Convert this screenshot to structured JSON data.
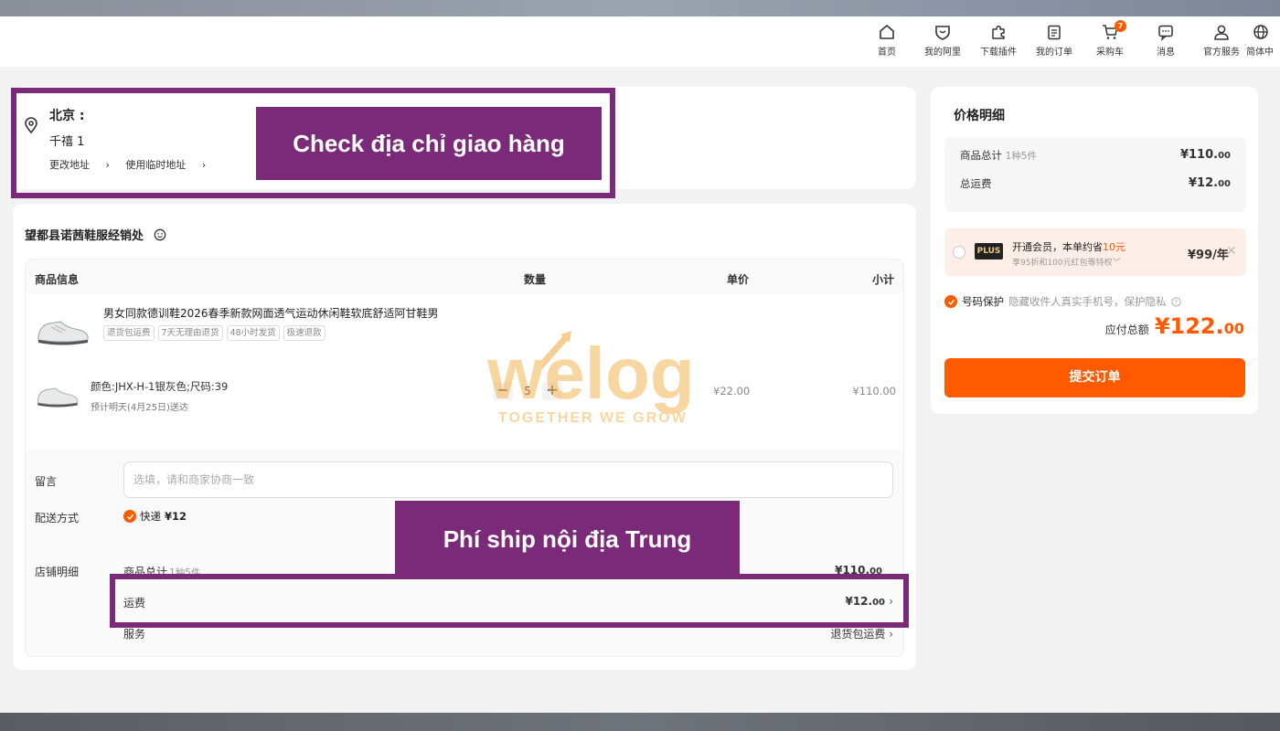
{
  "nav": {
    "items": [
      {
        "label": "首页",
        "icon": "home-icon"
      },
      {
        "label": "我的阿里",
        "icon": "heart-shield-icon"
      },
      {
        "label": "下载插件",
        "icon": "puzzle-icon"
      },
      {
        "label": "我的订单",
        "icon": "clipboard-icon"
      },
      {
        "label": "采购车",
        "icon": "cart-icon",
        "badge": "7"
      },
      {
        "label": "消息",
        "icon": "message-icon"
      },
      {
        "label": "官方服务",
        "icon": "user-icon"
      },
      {
        "label": "简体中",
        "icon": "globe-icon"
      }
    ]
  },
  "address": {
    "city": "北京 :",
    "detail": "千禧 1",
    "change_link": "更改地址",
    "temp_link": "使用临时地址"
  },
  "annotations": {
    "address": "Check địa chỉ giao hàng",
    "shipping": "Phí ship nội địa Trung"
  },
  "shop": {
    "name": "望都县诺茜鞋服经销处",
    "headers": {
      "info": "商品信息",
      "qty": "数量",
      "price": "单价",
      "subtotal": "小计"
    },
    "product": {
      "title": "男女同款德训鞋2026春季新款网面透气运动休闲鞋软底舒适阿甘鞋男",
      "tags": [
        "退货包运费",
        "7天无理由退货",
        "48小时发货",
        "极速退款"
      ],
      "sku": "颜色:JHX-H-1银灰色;尺码:39",
      "eta": "预计明天(4月25日)送达",
      "qty": "5",
      "unit_price": "¥22.00",
      "subtotal": "¥110.00"
    },
    "message": {
      "label": "留言",
      "placeholder": "选填，请和商家协商一致"
    },
    "delivery": {
      "label": "配送方式",
      "option": "快递",
      "fee": "¥12"
    },
    "detail": {
      "label": "店铺明细",
      "goods_label": "商品总计",
      "goods_count": "1种5件",
      "goods_int": "¥110.",
      "goods_dec": "00",
      "freight_label": "运费",
      "freight_int": "¥12.",
      "freight_dec": "00",
      "service_label": "服务",
      "service_value": "退货包运费"
    }
  },
  "watermark": {
    "brand": "welog",
    "slogan": "TOGETHER WE GROW"
  },
  "price_panel": {
    "title": "价格明细",
    "goods_label": "商品总计",
    "goods_count": "1种5件",
    "goods_int": "¥110.",
    "goods_dec": "00",
    "freight_label": "总运费",
    "freight_int": "¥12.",
    "freight_dec": "00",
    "plus": {
      "logo": "PLUS",
      "line1_prefix": "开通会员，本单约省",
      "line1_amount": "10元",
      "line2": "享95折和100元红包等特权",
      "price": "¥99/年"
    },
    "privacy": {
      "label": "号码保护",
      "desc": "隐藏收件人真实手机号，保护隐私"
    },
    "total_label": "应付总额",
    "total_int": "¥122.",
    "total_dec": "00",
    "submit": "提交订单"
  },
  "colors": {
    "accent": "#ff5a00",
    "annotation": "#7a2a78"
  }
}
